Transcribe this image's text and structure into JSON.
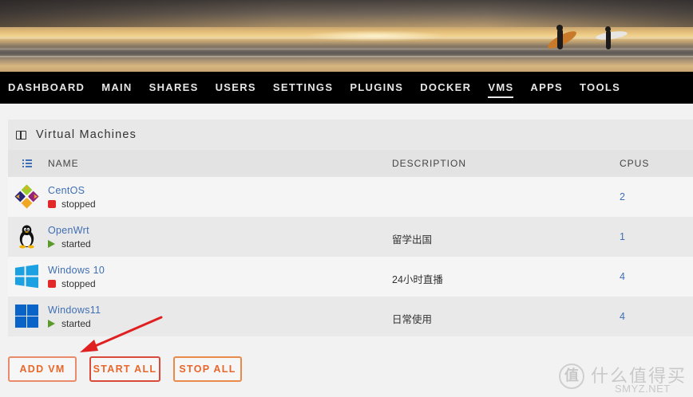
{
  "nav": {
    "items": [
      "DASHBOARD",
      "MAIN",
      "SHARES",
      "USERS",
      "SETTINGS",
      "PLUGINS",
      "DOCKER",
      "VMS",
      "APPS",
      "TOOLS"
    ],
    "active": "VMS"
  },
  "panel": {
    "title": "Virtual Machines",
    "headers": {
      "name": "NAME",
      "description": "DESCRIPTION",
      "cpus": "CPUS"
    }
  },
  "vms": [
    {
      "name": "CentOS",
      "state": "stopped",
      "description": "",
      "cpus": "2",
      "icon": "centos-icon"
    },
    {
      "name": "OpenWrt",
      "state": "started",
      "description": "留学出国",
      "cpus": "1",
      "icon": "linux-tux-icon"
    },
    {
      "name": "Windows 10",
      "state": "stopped",
      "description": "24小时直播",
      "cpus": "4",
      "icon": "windows10-icon"
    },
    {
      "name": "Windows11",
      "state": "started",
      "description": "日常使用",
      "cpus": "4",
      "icon": "windows11-icon"
    }
  ],
  "buttons": {
    "add_vm": "ADD VM",
    "start_all": "START ALL",
    "stop_all": "STOP ALL"
  },
  "colors": {
    "link": "#3f6fb4",
    "stopped": "#e22828",
    "started": "#5a9a2a",
    "button_text": "#e8662a",
    "arrow": "#e02020"
  },
  "watermark": {
    "logo": "值",
    "cn": "什么值得买",
    "en": "SMYZ.NET"
  }
}
